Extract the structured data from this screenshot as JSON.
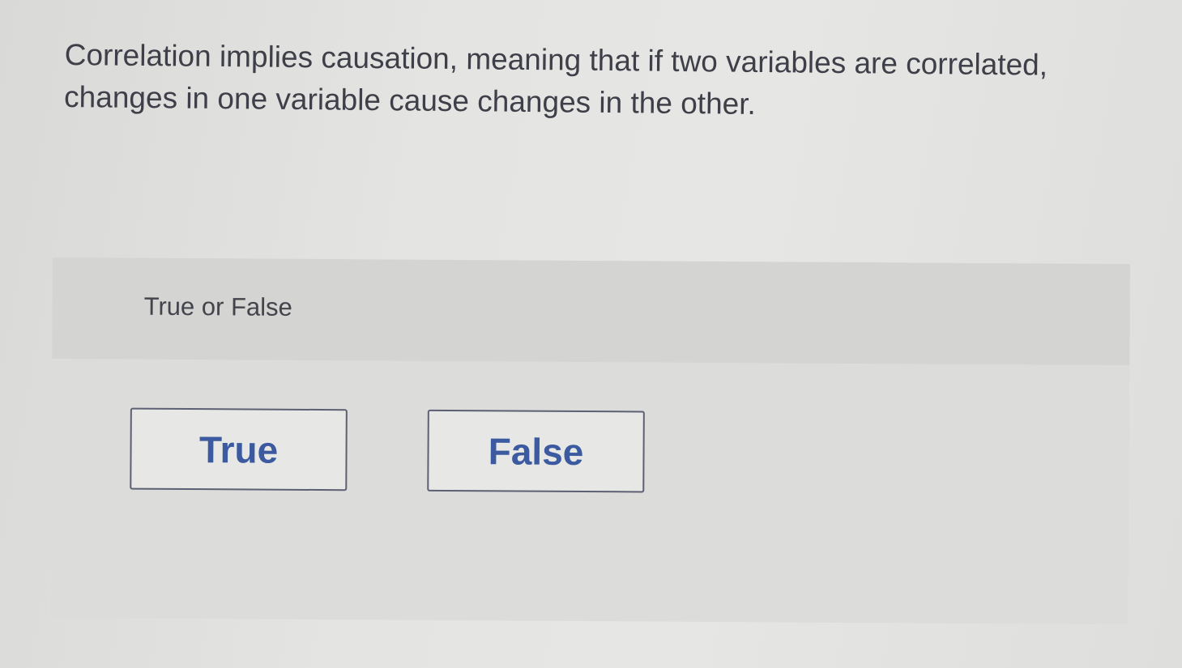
{
  "question": {
    "text": "Correlation implies causation, meaning that if two variables are correlated, changes in one variable cause changes in the other."
  },
  "answer_panel": {
    "prompt": "True or False",
    "choices": [
      {
        "label": "True"
      },
      {
        "label": "False"
      }
    ]
  },
  "colors": {
    "background": "#e3e3e1",
    "panel": "#dcdcda",
    "panel_header": "#d4d4d2",
    "text": "#3e3f48",
    "button_text": "#3b5aa0",
    "button_border": "#5d6073"
  }
}
